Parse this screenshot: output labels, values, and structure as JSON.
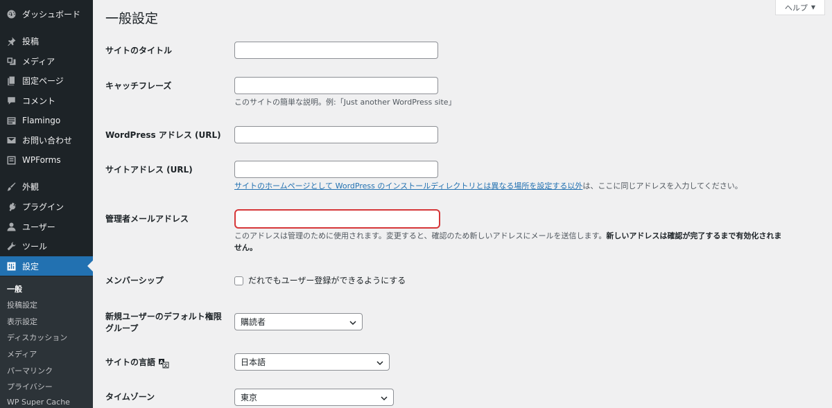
{
  "sidebar": {
    "items": [
      {
        "label": "ダッシュボード",
        "icon": "dashboard-icon"
      },
      {
        "label": "投稿",
        "icon": "pin-icon"
      },
      {
        "label": "メディア",
        "icon": "media-icon"
      },
      {
        "label": "固定ページ",
        "icon": "page-icon"
      },
      {
        "label": "コメント",
        "icon": "comment-icon"
      },
      {
        "label": "Flamingo",
        "icon": "flamingo-icon"
      },
      {
        "label": "お問い合わせ",
        "icon": "mail-icon"
      },
      {
        "label": "WPForms",
        "icon": "forms-icon"
      },
      {
        "label": "外観",
        "icon": "brush-icon"
      },
      {
        "label": "プラグイン",
        "icon": "plugin-icon"
      },
      {
        "label": "ユーザー",
        "icon": "user-icon"
      },
      {
        "label": "ツール",
        "icon": "wrench-icon"
      },
      {
        "label": "設定",
        "icon": "settings-icon"
      }
    ],
    "submenu": [
      "一般",
      "投稿設定",
      "表示設定",
      "ディスカッション",
      "メディア",
      "パーマリンク",
      "プライバシー",
      "WP Super Cache"
    ]
  },
  "help": {
    "label": "ヘルプ",
    "caret": "▼"
  },
  "page_title": "一般設定",
  "fields": {
    "site_title": {
      "label": "サイトのタイトル",
      "value": ""
    },
    "tagline": {
      "label": "キャッチフレーズ",
      "value": "",
      "desc": "このサイトの簡単な説明。例:「Just another WordPress site」"
    },
    "wp_address": {
      "label": "WordPress アドレス (URL)",
      "value": ""
    },
    "site_address": {
      "label": "サイトアドレス (URL)",
      "value": "",
      "desc_link": "サイトのホームページとして WordPress のインストールディレクトリとは異なる場所を設定する以外",
      "desc_rest": "は、ここに同じアドレスを入力してください。"
    },
    "admin_email": {
      "label": "管理者メールアドレス",
      "value": "",
      "desc_normal": "このアドレスは管理のために使用されます。変更すると、確認のため新しいアドレスにメールを送信します。",
      "desc_bold_1": "新しいアドレスは確認が完了するまで有効化されま",
      "desc_bold_2": "せん。"
    },
    "membership": {
      "label": "メンバーシップ",
      "checkbox_label": "だれでもユーザー登録ができるようにする",
      "checked": false
    },
    "default_role": {
      "label_1": "新規ユーザーのデフォルト権限",
      "label_2": "グループ",
      "value": "購読者"
    },
    "language": {
      "label": "サイトの言語",
      "value": "日本語"
    },
    "timezone": {
      "label": "タイムゾーン",
      "value": "東京"
    }
  },
  "colors": {
    "sidebar_bg": "#1d2327",
    "accent": "#2271b1",
    "error": "#d63638"
  }
}
